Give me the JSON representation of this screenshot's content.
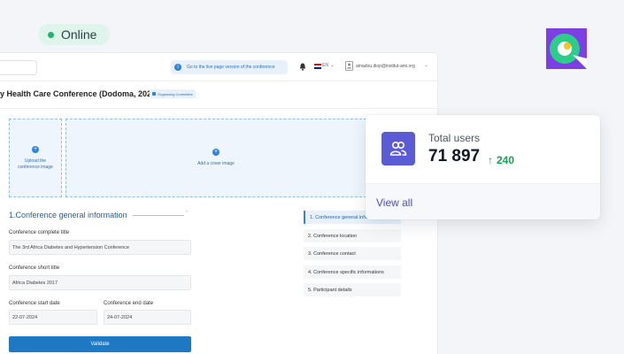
{
  "status": {
    "label": "Online",
    "dot_color": "#22b573"
  },
  "topbar": {
    "live_link": "Go to the live page version of the conference",
    "language": "EN",
    "user_email": "amadou.diop@institut-ami.org"
  },
  "page": {
    "title": "y Health Care Conference (Dodoma, 2024)",
    "badge": "Organizing Committee"
  },
  "upload": {
    "conference_image": "Upload the conference image",
    "cover_image": "Add a cover image"
  },
  "form": {
    "section_title": "1.Conference general information",
    "complete_title_label": "Conference complete title",
    "complete_title_value": "The 3rd Africa Diabetes and Hypertension Conference",
    "short_title_label": "Conference short title",
    "short_title_value": "Africa Diabetes 2017",
    "start_date_label": "Conference start date",
    "start_date_value": "22-07-2024",
    "end_date_label": "Conference end date",
    "end_date_value": "24-07-2024",
    "validate_label": "Validate"
  },
  "steps": [
    {
      "label": "1. Conference general information"
    },
    {
      "label": "2. Conference location"
    },
    {
      "label": "3. Conference contact"
    },
    {
      "label": "4. Conference specific informations"
    },
    {
      "label": "5. Participant details"
    }
  ],
  "stats": {
    "label": "Total users",
    "value": "71 897",
    "change": "240",
    "view_all": "View all",
    "accent": "#5b5bd6",
    "positive_color": "#14a44d"
  }
}
